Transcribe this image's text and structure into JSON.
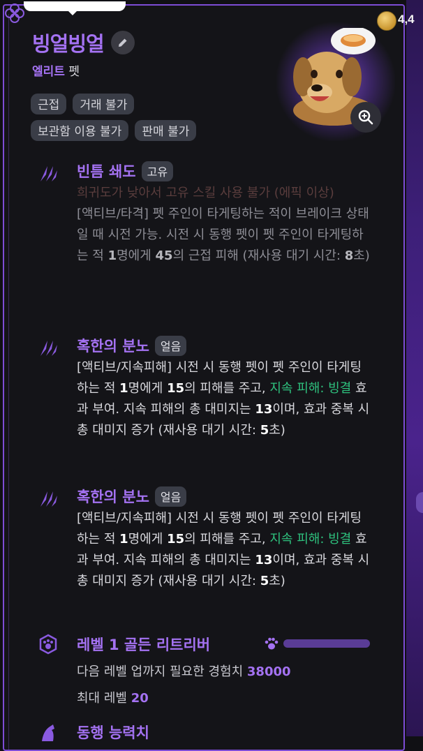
{
  "currency": {
    "amount": "4,4",
    "icon": "coin-icon"
  },
  "pet": {
    "name": "빙얼빙얼",
    "grade": "엘리트",
    "type": "펫",
    "tags": [
      "근접",
      "거래 불가",
      "보관함 이용 불가",
      "판매 불가"
    ]
  },
  "skills": [
    {
      "title": "빈틈 쇄도",
      "badge": "고유",
      "warning": "희귀도가 낮아서 고유 스킬 사용 불가 (에픽 이상)",
      "desc_a": "[액티브/타격] 펫 주인이 타게팅하는 적이 브레이크 상태일 때 시전 가능. 시전 시 동행 펫이 펫 주인이 타게팅하는 적 ",
      "n1": "1",
      "desc_b": "명에게 ",
      "n2": "45",
      "desc_c": "의 근접 피해 (재사용 대기 시간: ",
      "n3": "8",
      "desc_d": "초)"
    },
    {
      "title": "혹한의 분노",
      "badge": "얼음",
      "desc_a": "[액티브/지속피해] 시전 시 동행 펫이 펫 주인이 타게팅하는 적 ",
      "n1": "1",
      "desc_b": "명에게 ",
      "n2": "15",
      "desc_c": "의 피해를 주고, ",
      "green": "지속 피해: 빙결",
      "desc_d": " 효과 부여. 지속 피해의 총 대미지는 ",
      "n3": "13",
      "desc_e": "이며, 효과 중복 시 총 대미지 증가 (재사용 대기 시간: ",
      "n4": "5",
      "desc_f": "초)"
    },
    {
      "title": "혹한의 분노",
      "badge": "얼음",
      "desc_a": "[액티브/지속피해] 시전 시 동행 펫이 펫 주인이 타게팅하는 적 ",
      "n1": "1",
      "desc_b": "명에게 ",
      "n2": "15",
      "desc_c": "의 피해를 주고, ",
      "green": "지속 피해: 빙결",
      "desc_d": " 효과 부여. 지속 피해의 총 대미지는 ",
      "n3": "13",
      "desc_e": "이며, 효과 중복 시 총 대미지 증가 (재사용 대기 시간: ",
      "n4": "5",
      "desc_f": "초)"
    }
  ],
  "level": {
    "title": "레벨 1 골든 리트리버",
    "progress_fraction": 0.0,
    "exp_label": "다음 레벨 업까지 필요한 경험치 ",
    "exp_value": "38000",
    "max_label": "최대 레벨 ",
    "max_value": "20"
  },
  "next_section": {
    "title": "동행 능력치"
  },
  "colors": {
    "accent": "#a472f2",
    "green": "#2ec27e",
    "border": "#7d4cd6"
  }
}
